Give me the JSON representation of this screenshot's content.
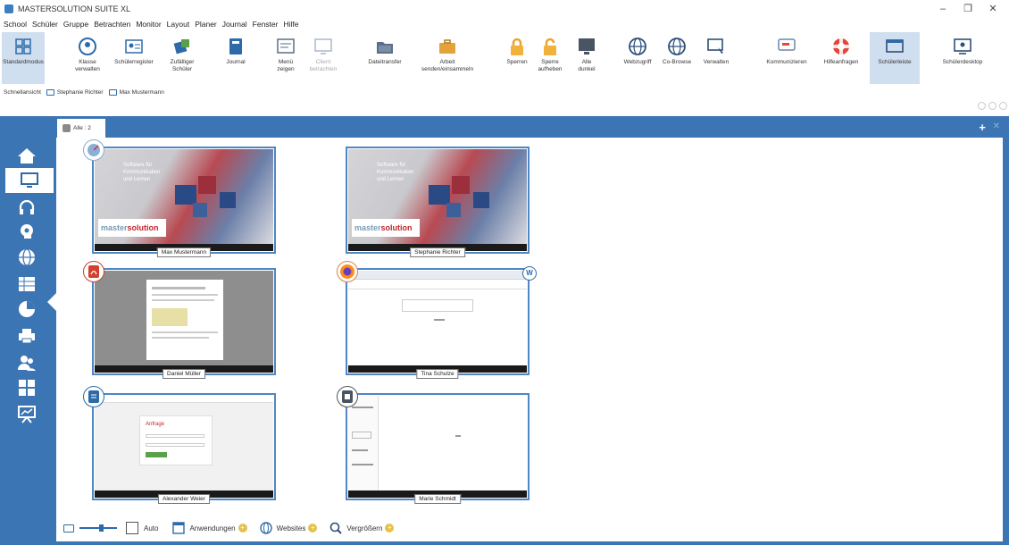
{
  "window": {
    "title": "MASTERSOLUTION SUITE XL",
    "minimize": "–",
    "restore": "❐",
    "close": "✕"
  },
  "menu": [
    "School",
    "Schüler",
    "Gruppe",
    "Betrachten",
    "Monitor",
    "Layout",
    "Planer",
    "Journal",
    "Fenster",
    "Hilfe"
  ],
  "ribbon": [
    {
      "label": "Standardmodus",
      "icon": "grid-icon",
      "active": true
    },
    {
      "label": "Klasse\nverwalten",
      "icon": "class-icon"
    },
    {
      "label": "Schülerregister",
      "icon": "register-icon"
    },
    {
      "label": "Zufälliger\nSchüler",
      "icon": "random-student-icon"
    },
    {
      "label": "Journal",
      "icon": "journal-icon"
    },
    {
      "label": "Menü\nzeigen",
      "icon": "menu-icon"
    },
    {
      "label": "Client\nbetrachten",
      "icon": "client-view-icon",
      "disabled": true
    },
    {
      "label": "Dateitransfer",
      "icon": "folder-icon"
    },
    {
      "label": "Arbeit\nsenden/einsammeln",
      "icon": "briefcase-icon"
    },
    {
      "label": "Sperren",
      "icon": "lock-icon"
    },
    {
      "label": "Sperre\naufheben",
      "icon": "unlock-icon"
    },
    {
      "label": "Alle\ndunkel",
      "icon": "monitor-dark-icon"
    },
    {
      "label": "Webzugriff",
      "icon": "globe-icon"
    },
    {
      "label": "Co-Browse",
      "icon": "co-browse-icon"
    },
    {
      "label": "Verwalten",
      "icon": "manage-icon"
    },
    {
      "label": "Kommunizieren",
      "icon": "chat-icon"
    },
    {
      "label": "Hilfeanfragen",
      "icon": "lifebuoy-icon"
    },
    {
      "label": "Schülerleiste",
      "icon": "student-bar-icon",
      "active": true
    },
    {
      "label": "Schülerdesktop",
      "icon": "student-desktop-icon"
    }
  ],
  "quickbar": {
    "label": "Schnellansicht",
    "items": [
      "Stephanie Richter",
      "Max Mustermann"
    ]
  },
  "tab": {
    "label": "Alle : 2",
    "add": "+",
    "close": "✕"
  },
  "students": [
    {
      "name": "Max Mustermann",
      "screen": "wallpaper",
      "app": "pointer-app-icon"
    },
    {
      "name": "Stephanie Richter",
      "screen": "wallpaper",
      "app": ""
    },
    {
      "name": "Daniel Müller",
      "screen": "pdf",
      "app": "pdf-app-icon"
    },
    {
      "name": "Tina Schulze",
      "screen": "browser",
      "app": "firefox-app-icon",
      "badge": "W"
    },
    {
      "name": "Alexander Weier",
      "screen": "form",
      "app": "doc-app-icon"
    },
    {
      "name": "Marie Schmidt",
      "screen": "sheet",
      "app": "sheet-app-icon"
    }
  ],
  "wallpaper": {
    "text": "Software für\nKommunikation\nund Lernen",
    "brand_a": "master",
    "brand_b": "solution"
  },
  "form_card_title": "Anfrage",
  "bottombar": {
    "auto": "Auto",
    "apps": "Anwendungen",
    "websites": "Websites",
    "zoom": "Vergrößern",
    "plus": "+"
  },
  "colors": {
    "accent": "#3c75b4",
    "active_tab": "#cfdfef",
    "badge_plus": "#e3c14d"
  }
}
